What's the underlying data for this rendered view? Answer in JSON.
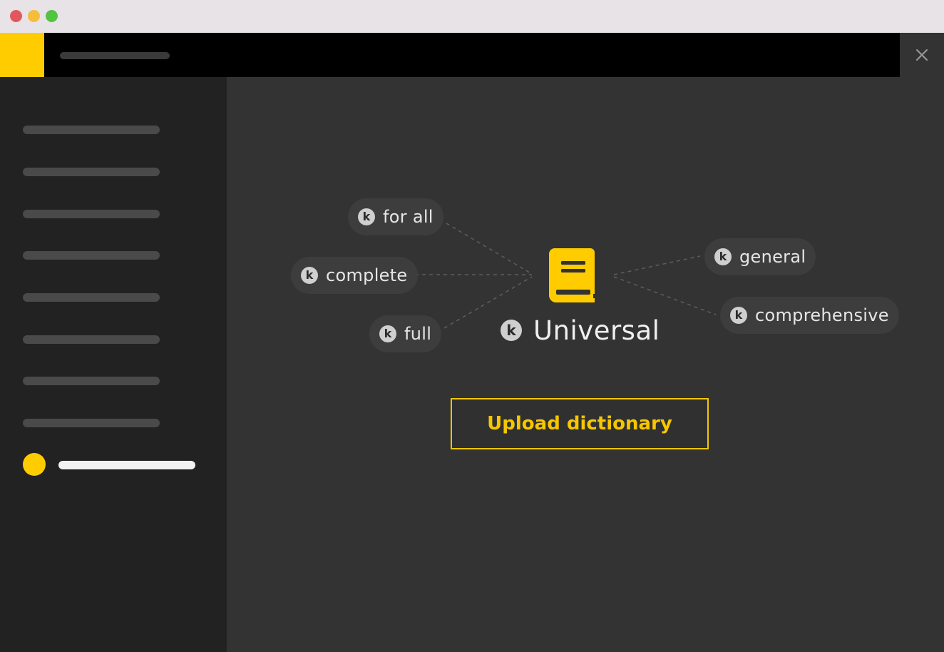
{
  "colors": {
    "accent": "#ffcc00",
    "traffic_red": "#e0585e",
    "traffic_yellow": "#f5bd3a",
    "traffic_green": "#55c342"
  },
  "window": {
    "close_icon": "close-icon"
  },
  "sidebar": {
    "item_count": 8,
    "active_icon": "active-dot"
  },
  "graph": {
    "badge_letter": "k",
    "center": {
      "icon": "book-icon",
      "label": "Universal"
    },
    "tags_left": [
      {
        "label": "for all"
      },
      {
        "label": "complete"
      },
      {
        "label": "full"
      }
    ],
    "tags_right": [
      {
        "label": "general"
      },
      {
        "label": "comprehensive"
      }
    ]
  },
  "actions": {
    "upload_label": "Upload dictionary"
  }
}
